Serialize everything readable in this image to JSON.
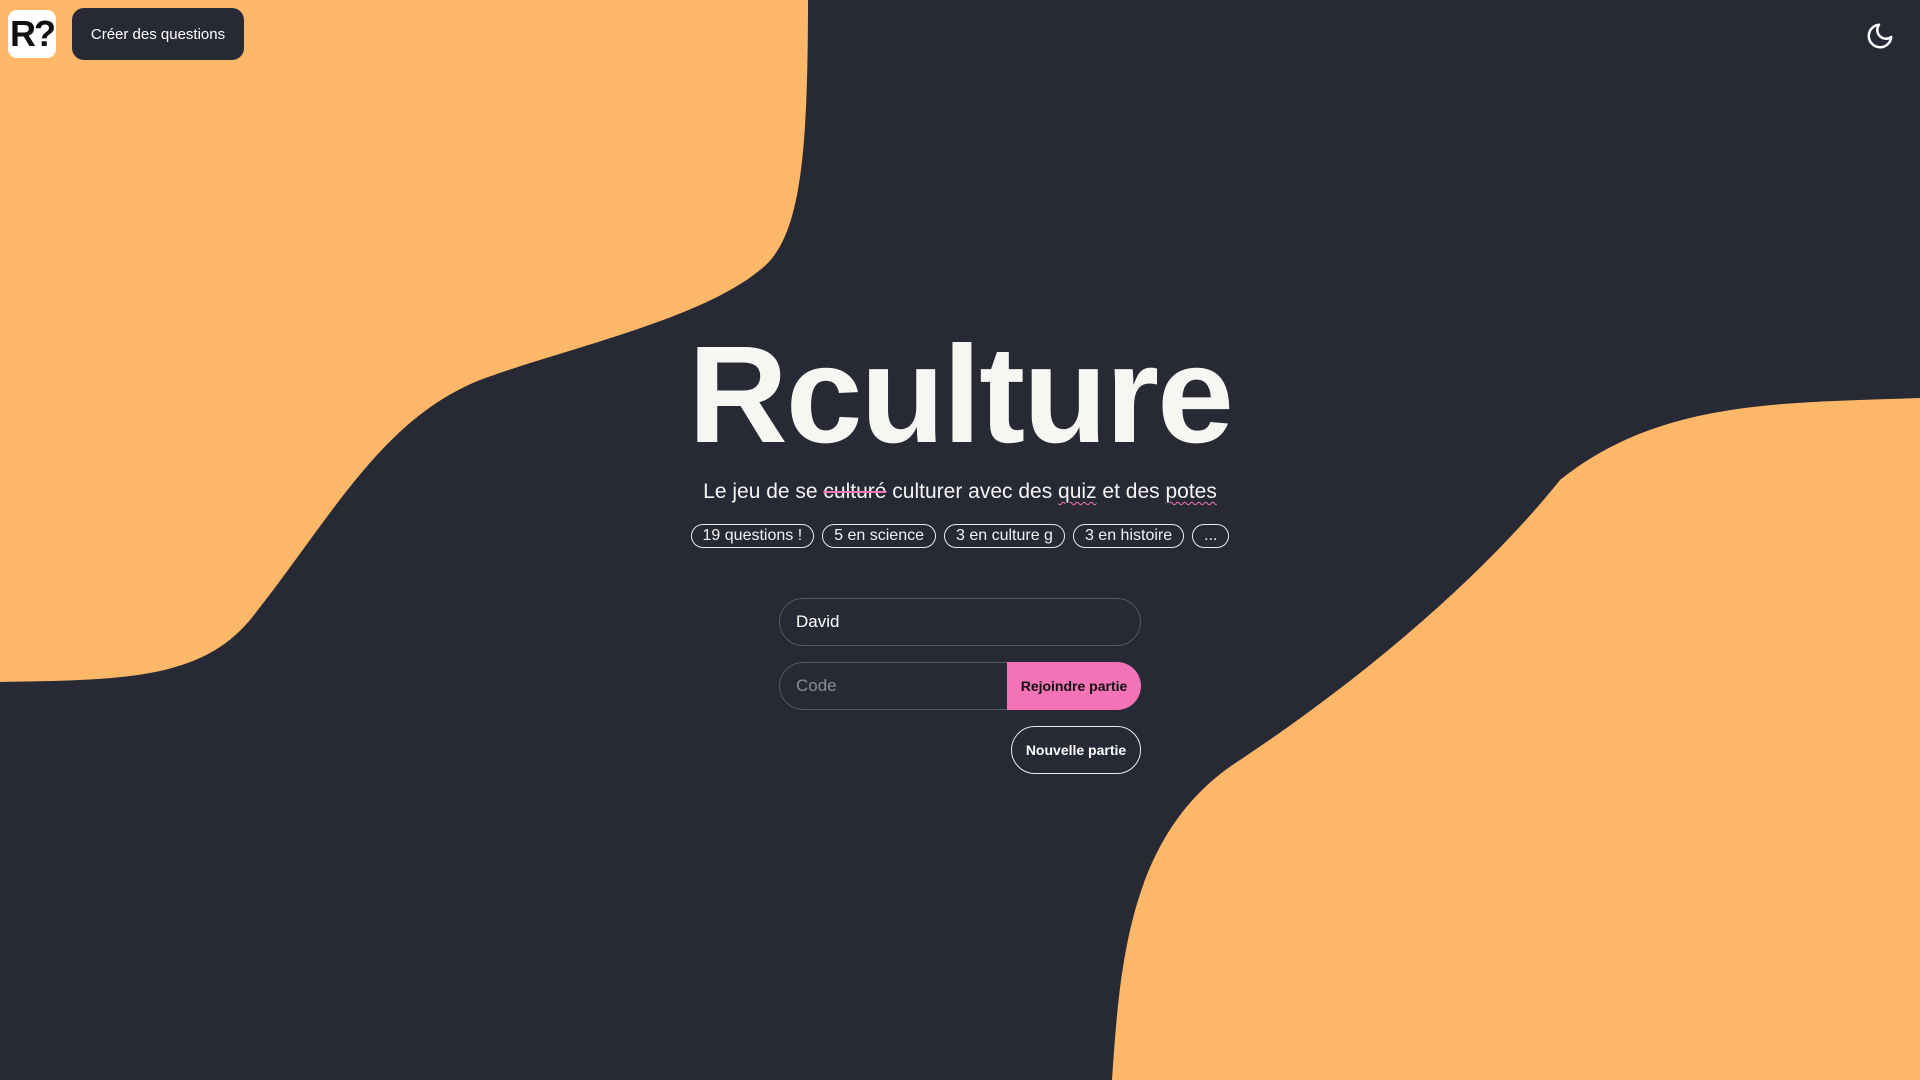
{
  "colors": {
    "background": "#272935",
    "blob": "#FDB769",
    "accent": "#F472B6",
    "text": "#F7F6F2"
  },
  "header": {
    "logo_text": "R?",
    "create_questions_label": "Créer des questions",
    "theme_toggle_icon": "moon-icon"
  },
  "hero": {
    "title": "Rculture",
    "subtitle": {
      "part1": "Le jeu de se ",
      "struck": "culturé",
      "part2": " culturer avec des ",
      "word_quiz": "quiz",
      "part3": " et des ",
      "word_potes": "potes"
    },
    "tags": [
      "19 questions !",
      "5 en science",
      "3 en culture g",
      "3 en histoire",
      "..."
    ]
  },
  "form": {
    "name_value": "David",
    "code_placeholder": "Code",
    "join_label": "Rejoindre partie",
    "new_game_label": "Nouvelle partie"
  }
}
